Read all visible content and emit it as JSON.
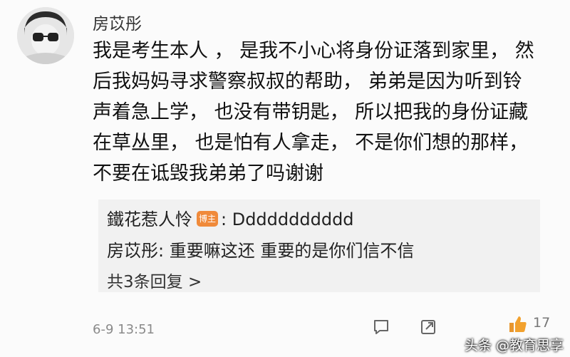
{
  "comment": {
    "username": "房苡彤",
    "lines": [
      "我是考生本人 ， 是我不小心将身份证落到家里， 然",
      "后我妈妈寻求警察叔叔的帮助， 弟弟是因为听到铃",
      "声着急上学， 也没有带钥匙， 所以把我的身份证藏",
      "在草丛里， 也是怕有人拿走， 不是你们想的那样，",
      "不要在诋毁我弟弟了吗谢谢"
    ],
    "timestamp": "6-9 13:51",
    "like_count": "17"
  },
  "replies": {
    "items": [
      {
        "author": "鐵花惹人怜",
        "badge": "博主",
        "text": ": Ddddddddddd"
      },
      {
        "author": "房苡彤",
        "badge": "",
        "text": ": 重要嘛这还 重要的是你们信不信"
      }
    ],
    "more_link": "共3条回复 >"
  },
  "watermark": "头条 @教育思享",
  "icons": {
    "reply": "speech-bubble-icon",
    "share": "share-icon",
    "like": "thumbs-up-icon"
  },
  "colors": {
    "badge": "#f08a3a",
    "reply_background": "#f1f1f1",
    "background": "#fbfbfb"
  }
}
